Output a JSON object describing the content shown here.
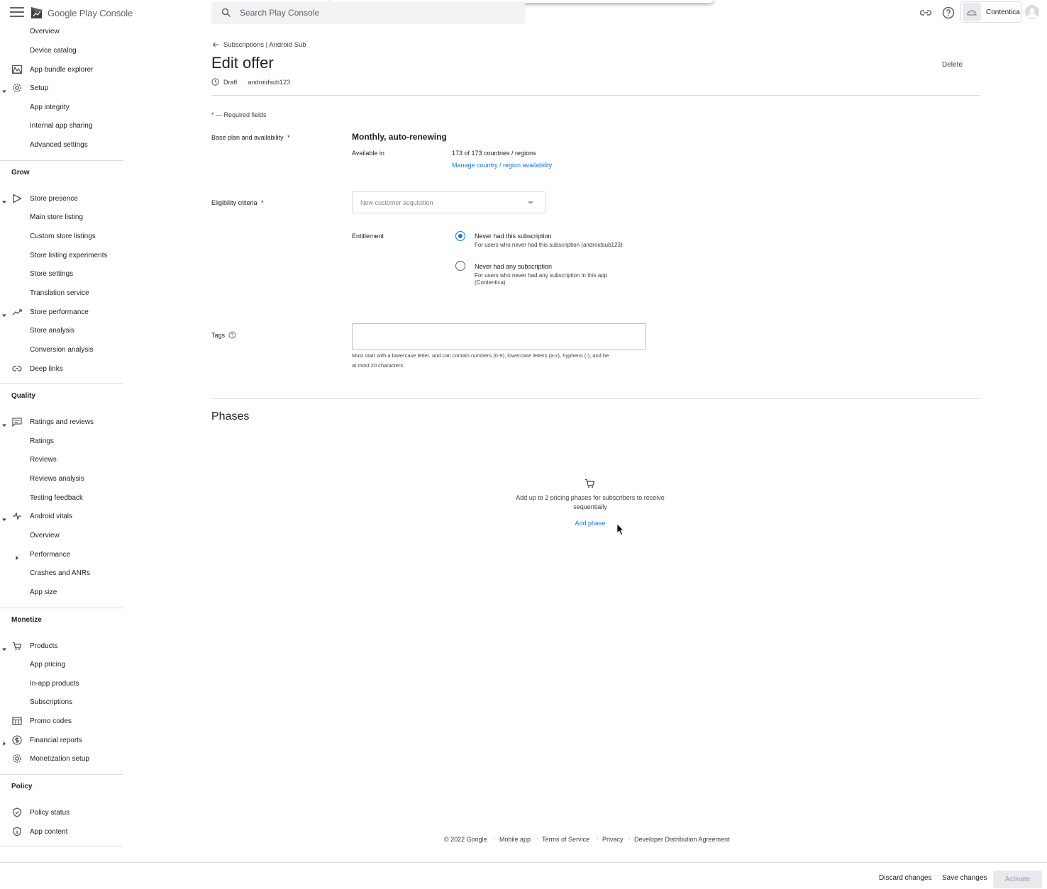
{
  "topbar": {
    "logo_text": "Google Play Console",
    "search_placeholder": "Search Play Console",
    "app_name": "Contentica"
  },
  "sidebar": {
    "items": [
      {
        "label": "Overview"
      },
      {
        "label": "Device catalog"
      },
      {
        "label": "App bundle explorer"
      },
      {
        "label": "Setup"
      },
      {
        "label": "App integrity"
      },
      {
        "label": "Internal app sharing"
      },
      {
        "label": "Advanced settings"
      },
      {
        "label": "Store presence"
      },
      {
        "label": "Main store listing"
      },
      {
        "label": "Custom store listings"
      },
      {
        "label": "Store listing experiments"
      },
      {
        "label": "Store settings"
      },
      {
        "label": "Translation service"
      },
      {
        "label": "Store performance"
      },
      {
        "label": "Store analysis"
      },
      {
        "label": "Conversion analysis"
      },
      {
        "label": "Deep links"
      },
      {
        "label": "Ratings and reviews"
      },
      {
        "label": "Ratings"
      },
      {
        "label": "Reviews"
      },
      {
        "label": "Reviews analysis"
      },
      {
        "label": "Testing feedback"
      },
      {
        "label": "Android vitals"
      },
      {
        "label": "Overview"
      },
      {
        "label": "Performance"
      },
      {
        "label": "Crashes and ANRs"
      },
      {
        "label": "App size"
      },
      {
        "label": "Products"
      },
      {
        "label": "App pricing"
      },
      {
        "label": "In-app products"
      },
      {
        "label": "Subscriptions"
      },
      {
        "label": "Promo codes"
      },
      {
        "label": "Financial reports"
      },
      {
        "label": "Monetization setup"
      },
      {
        "label": "Policy status"
      },
      {
        "label": "App content"
      }
    ],
    "sections": {
      "grow": "Grow",
      "quality": "Quality",
      "monetize": "Monetize",
      "policy": "Policy"
    }
  },
  "page": {
    "breadcrumb": "Subscriptions | Android Sub",
    "title": "Edit offer",
    "delete_label": "Delete",
    "status": "Draft",
    "product_id": "androidsub123",
    "required_note": "* — Required fields"
  },
  "form": {
    "base_plan_label": "Base plan and availability",
    "required_star": "*",
    "base_plan_value": "Monthly, auto-renewing",
    "available_in_label": "Available in",
    "available_in_value": "173 of 173 countries / regions",
    "manage_link": "Manage country / region availability",
    "eligibility_label": "Eligibility criteria",
    "eligibility_value": "New customer acquisition",
    "entitlement_label": "Entitlement",
    "option1_title": "Never had this subscription",
    "option1_desc": "For users who never had this subscription (androidsub123)",
    "option2_title": "Never had any subscription",
    "option2_desc_line1": "For users who never had any subscription in this app",
    "option2_desc_line2": "(Contentica)",
    "tags_label": "Tags",
    "tags_value": "",
    "tags_help_line1": "Must start with a lowercase letter, and can contain numbers (0-9), lowercase letters (a-z), hyphens (-), and be",
    "tags_help_line2": "at most 20 characters."
  },
  "phases": {
    "title": "Phases",
    "empty_line1": "Add up to 2 pricing phases for subscribers to receive",
    "empty_line2": "sequentially",
    "add_label": "Add phase"
  },
  "footer": {
    "copyright": "© 2022 Google",
    "mobile_app": "Mobile app",
    "terms": "Terms of Service",
    "privacy": "Privacy",
    "dda": "Developer Distribution Agreement",
    "sep": "·"
  },
  "bottombar": {
    "discard": "Discard changes",
    "save": "Save changes",
    "activate": "Activate"
  },
  "colors": {
    "accent": "#1a73e8",
    "text": "#202124",
    "divider": "#dadce0"
  }
}
